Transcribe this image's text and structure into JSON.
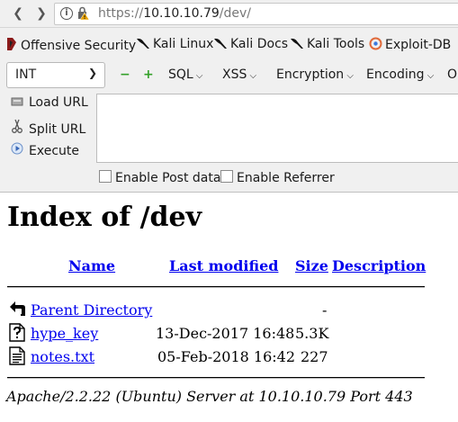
{
  "browser": {
    "url_scheme": "https://",
    "url_host": "10.10.10.79",
    "url_path": "/dev/"
  },
  "bookmarks": [
    {
      "label": "Offensive Security",
      "icon": "offsec-icon"
    },
    {
      "label": "Kali Linux",
      "icon": "kali-dragon-icon"
    },
    {
      "label": "Kali Docs",
      "icon": "kali-dragon-icon"
    },
    {
      "label": "Kali Tools",
      "icon": "kali-dragon-icon"
    },
    {
      "label": "Exploit-DB",
      "icon": "exploit-db-icon"
    }
  ],
  "hackbar": {
    "select_value": "INT",
    "menus": [
      "SQL",
      "XSS",
      "Encryption",
      "Encoding",
      "O"
    ],
    "load_url": "Load URL",
    "split_url": "Split URL",
    "execute": "Execute",
    "enable_post": "Enable Post data",
    "enable_referrer": "Enable Referrer"
  },
  "page": {
    "title": "Index of /dev",
    "columns": {
      "name": "Name",
      "last_modified": "Last modified",
      "size": "Size",
      "description": "Description"
    },
    "parent": {
      "name": "Parent Directory",
      "size": "-",
      "icon": "back-arrow-icon"
    },
    "files": [
      {
        "name": "hype_key",
        "modified": "13-Dec-2017 16:48",
        "size": "5.3K",
        "icon": "unknown-file-icon"
      },
      {
        "name": "notes.txt",
        "modified": "05-Feb-2018 16:42",
        "size": "227",
        "icon": "text-file-icon"
      }
    ],
    "footer": "Apache/2.2.22 (Ubuntu) Server at 10.10.10.79 Port 443"
  },
  "colors": {
    "link": "#0000ee",
    "chrome_bg": "#f0f0f0",
    "lock_warning": "#e8a200"
  }
}
